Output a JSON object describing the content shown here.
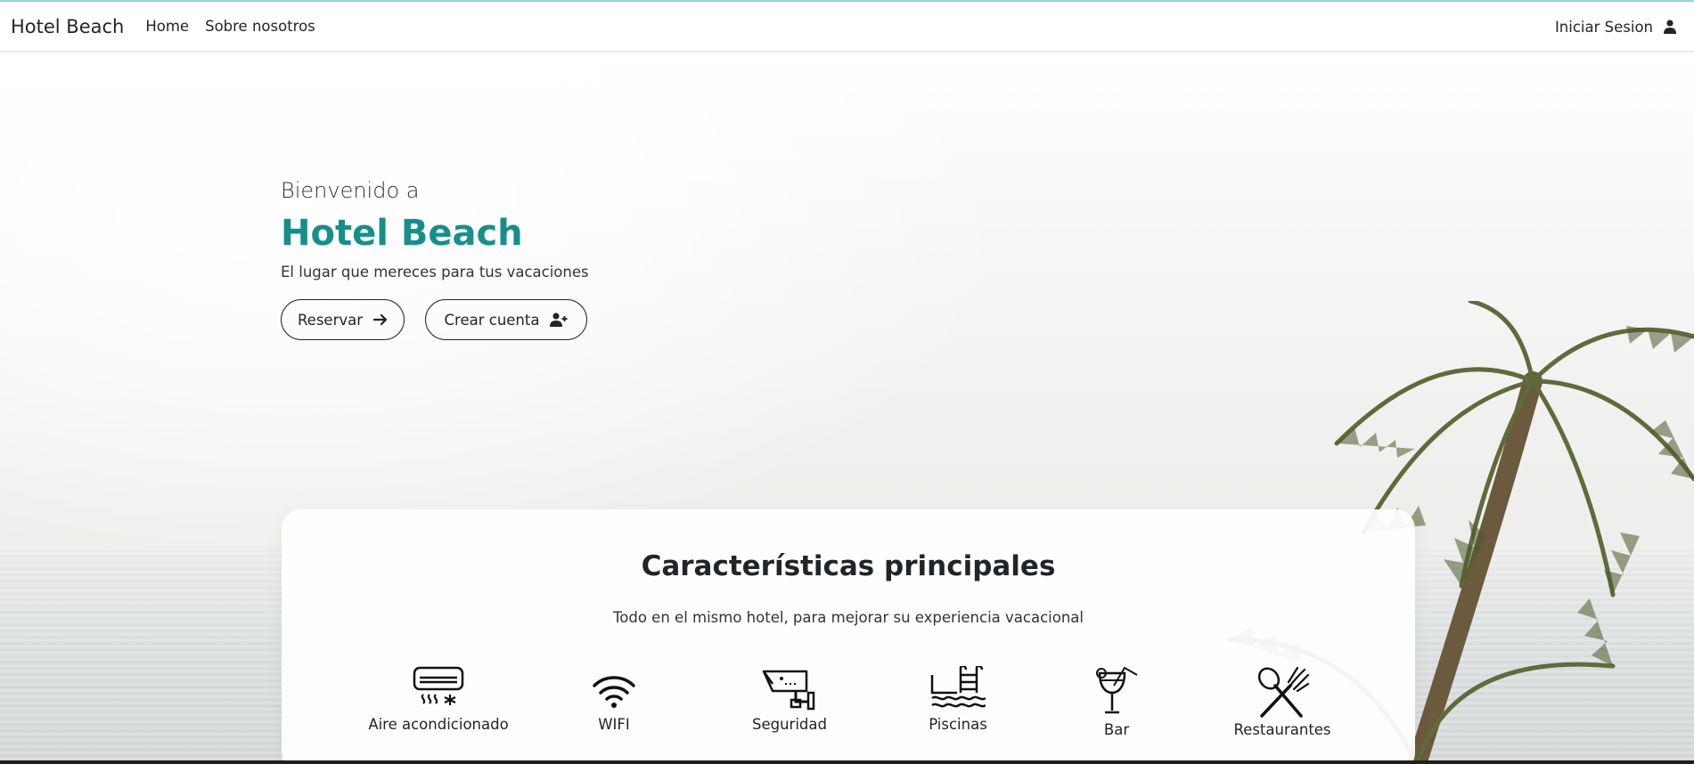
{
  "navbar": {
    "brand": "Hotel Beach",
    "links": [
      "Home",
      "Sobre nosotros"
    ],
    "login_label": "Iniciar Sesion",
    "login_icon": "user-icon"
  },
  "hero": {
    "welcome": "Bienvenido a",
    "title": "Hotel Beach",
    "subtitle": "El lugar que mereces para tus vacaciones",
    "buttons": {
      "reservar": {
        "label": "Reservar",
        "icon": "arrow-right-icon"
      },
      "crear": {
        "label": "Crear cuenta",
        "icon": "user-plus-icon"
      }
    },
    "accent_color": "#168f8a"
  },
  "features": {
    "title": "Características principales",
    "subtitle": "Todo en el mismo hotel, para mejorar su experiencia vacacional",
    "items": [
      {
        "label": "Aire acondicionado",
        "icon": "air-conditioner-icon"
      },
      {
        "label": "WIFI",
        "icon": "wifi-icon"
      },
      {
        "label": "Seguridad",
        "icon": "security-camera-icon"
      },
      {
        "label": "Piscinas",
        "icon": "pool-icon"
      },
      {
        "label": "Bar",
        "icon": "cocktail-icon"
      },
      {
        "label": "Restaurantes",
        "icon": "spoon-fork-icon"
      }
    ]
  }
}
